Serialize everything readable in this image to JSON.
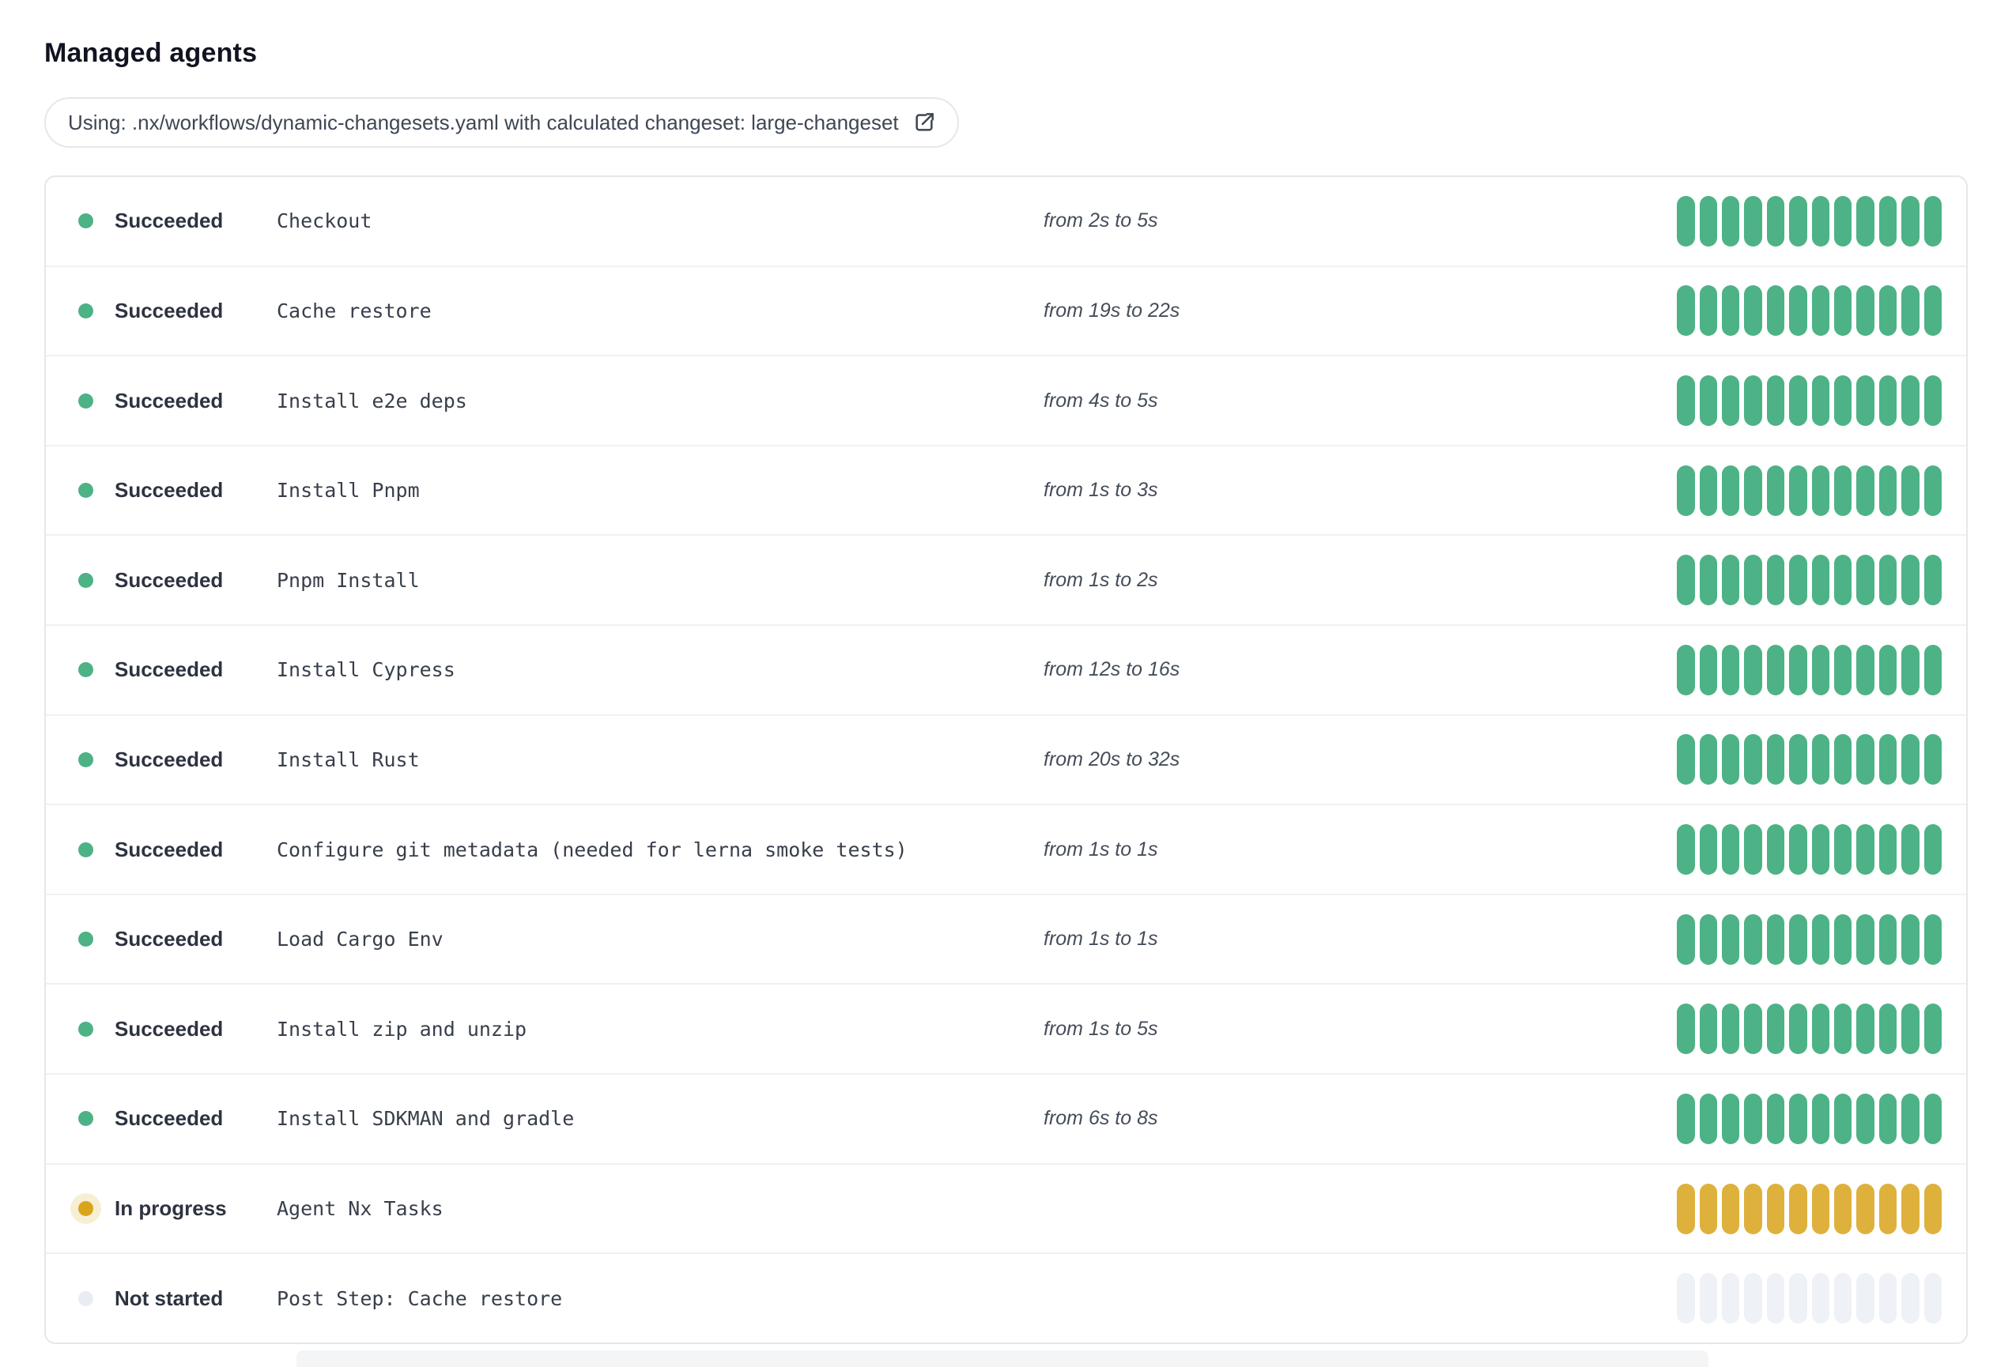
{
  "page": {
    "title": "Managed agents"
  },
  "banner": {
    "text": "Using: .nx/workflows/dynamic-changesets.yaml with calculated changeset: large-changeset",
    "icon": "external-link-icon"
  },
  "colors": {
    "segment": {
      "succeeded": "#4db286",
      "in_progress": "#deb13c",
      "not_started": "#eef1f5"
    },
    "dot": {
      "succeeded": "#4db286",
      "in_progress": "#d9a41b",
      "not_started": "#e9edf3"
    },
    "dot_halo_in_progress": "#f7efd3",
    "card_border": "#e5e7eb",
    "row_divider": "#f0f1f3"
  },
  "agents_table": {
    "segments_per_row": 12,
    "rows": [
      {
        "status": "Succeeded",
        "status_key": "succeeded",
        "step": "Checkout",
        "duration": "from 2s to 5s"
      },
      {
        "status": "Succeeded",
        "status_key": "succeeded",
        "step": "Cache restore",
        "duration": "from 19s to 22s"
      },
      {
        "status": "Succeeded",
        "status_key": "succeeded",
        "step": "Install e2e deps",
        "duration": "from 4s to 5s"
      },
      {
        "status": "Succeeded",
        "status_key": "succeeded",
        "step": "Install Pnpm",
        "duration": "from 1s to 3s"
      },
      {
        "status": "Succeeded",
        "status_key": "succeeded",
        "step": "Pnpm Install",
        "duration": "from 1s to 2s"
      },
      {
        "status": "Succeeded",
        "status_key": "succeeded",
        "step": "Install Cypress",
        "duration": "from 12s to 16s"
      },
      {
        "status": "Succeeded",
        "status_key": "succeeded",
        "step": "Install Rust",
        "duration": "from 20s to 32s"
      },
      {
        "status": "Succeeded",
        "status_key": "succeeded",
        "step": "Configure git metadata (needed for lerna smoke tests)",
        "duration": "from 1s to 1s"
      },
      {
        "status": "Succeeded",
        "status_key": "succeeded",
        "step": "Load Cargo Env",
        "duration": "from 1s to 1s"
      },
      {
        "status": "Succeeded",
        "status_key": "succeeded",
        "step": "Install zip and unzip",
        "duration": "from 1s to 5s"
      },
      {
        "status": "Succeeded",
        "status_key": "succeeded",
        "step": "Install SDKMAN and gradle",
        "duration": "from 6s to 8s"
      },
      {
        "status": "In progress",
        "status_key": "in_progress",
        "step": "Agent Nx Tasks",
        "duration": ""
      },
      {
        "status": "Not started",
        "status_key": "not_started",
        "step": "Post Step: Cache restore",
        "duration": ""
      }
    ]
  }
}
